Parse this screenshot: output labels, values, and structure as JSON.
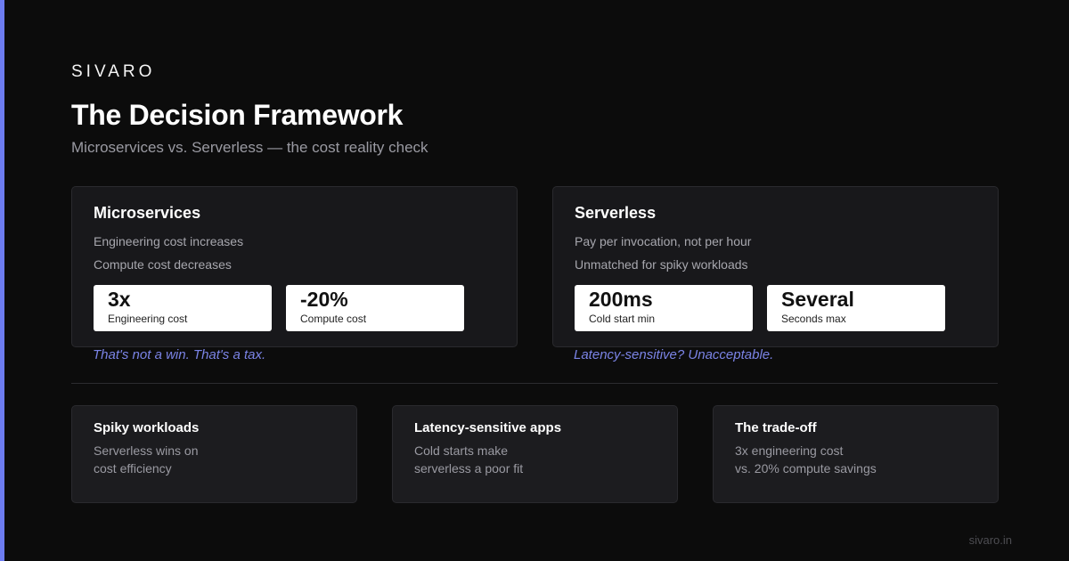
{
  "brand": "SIVARO",
  "title": "The Decision Framework",
  "subtitle": "Microservices vs. Serverless — the cost reality check",
  "colors": {
    "accent": "#6d7cf0",
    "background": "#0c0c0c",
    "card": "#18181b"
  },
  "cards": [
    {
      "title": "Microservices",
      "lines": [
        "Engineering cost increases",
        "Compute cost decreases"
      ],
      "stats": [
        {
          "value": "3x",
          "label": "Engineering cost"
        },
        {
          "value": "-20%",
          "label": "Compute cost"
        }
      ],
      "note": "That's not a win. That's a tax."
    },
    {
      "title": "Serverless",
      "lines": [
        "Pay per invocation, not per hour",
        "Unmatched for spiky workloads"
      ],
      "stats": [
        {
          "value": "200ms",
          "label": "Cold start min"
        },
        {
          "value": "Several",
          "label": "Seconds max"
        }
      ],
      "note": "Latency-sensitive? Unacceptable."
    }
  ],
  "summary": [
    {
      "title": "Spiky workloads",
      "lines": [
        "Serverless wins on",
        "cost efficiency"
      ]
    },
    {
      "title": "Latency-sensitive apps",
      "lines": [
        "Cold starts make",
        "serverless a poor fit"
      ]
    },
    {
      "title": "The trade-off",
      "lines": [
        "3x engineering cost",
        "vs. 20% compute savings"
      ]
    }
  ],
  "footer": "sivaro.in"
}
